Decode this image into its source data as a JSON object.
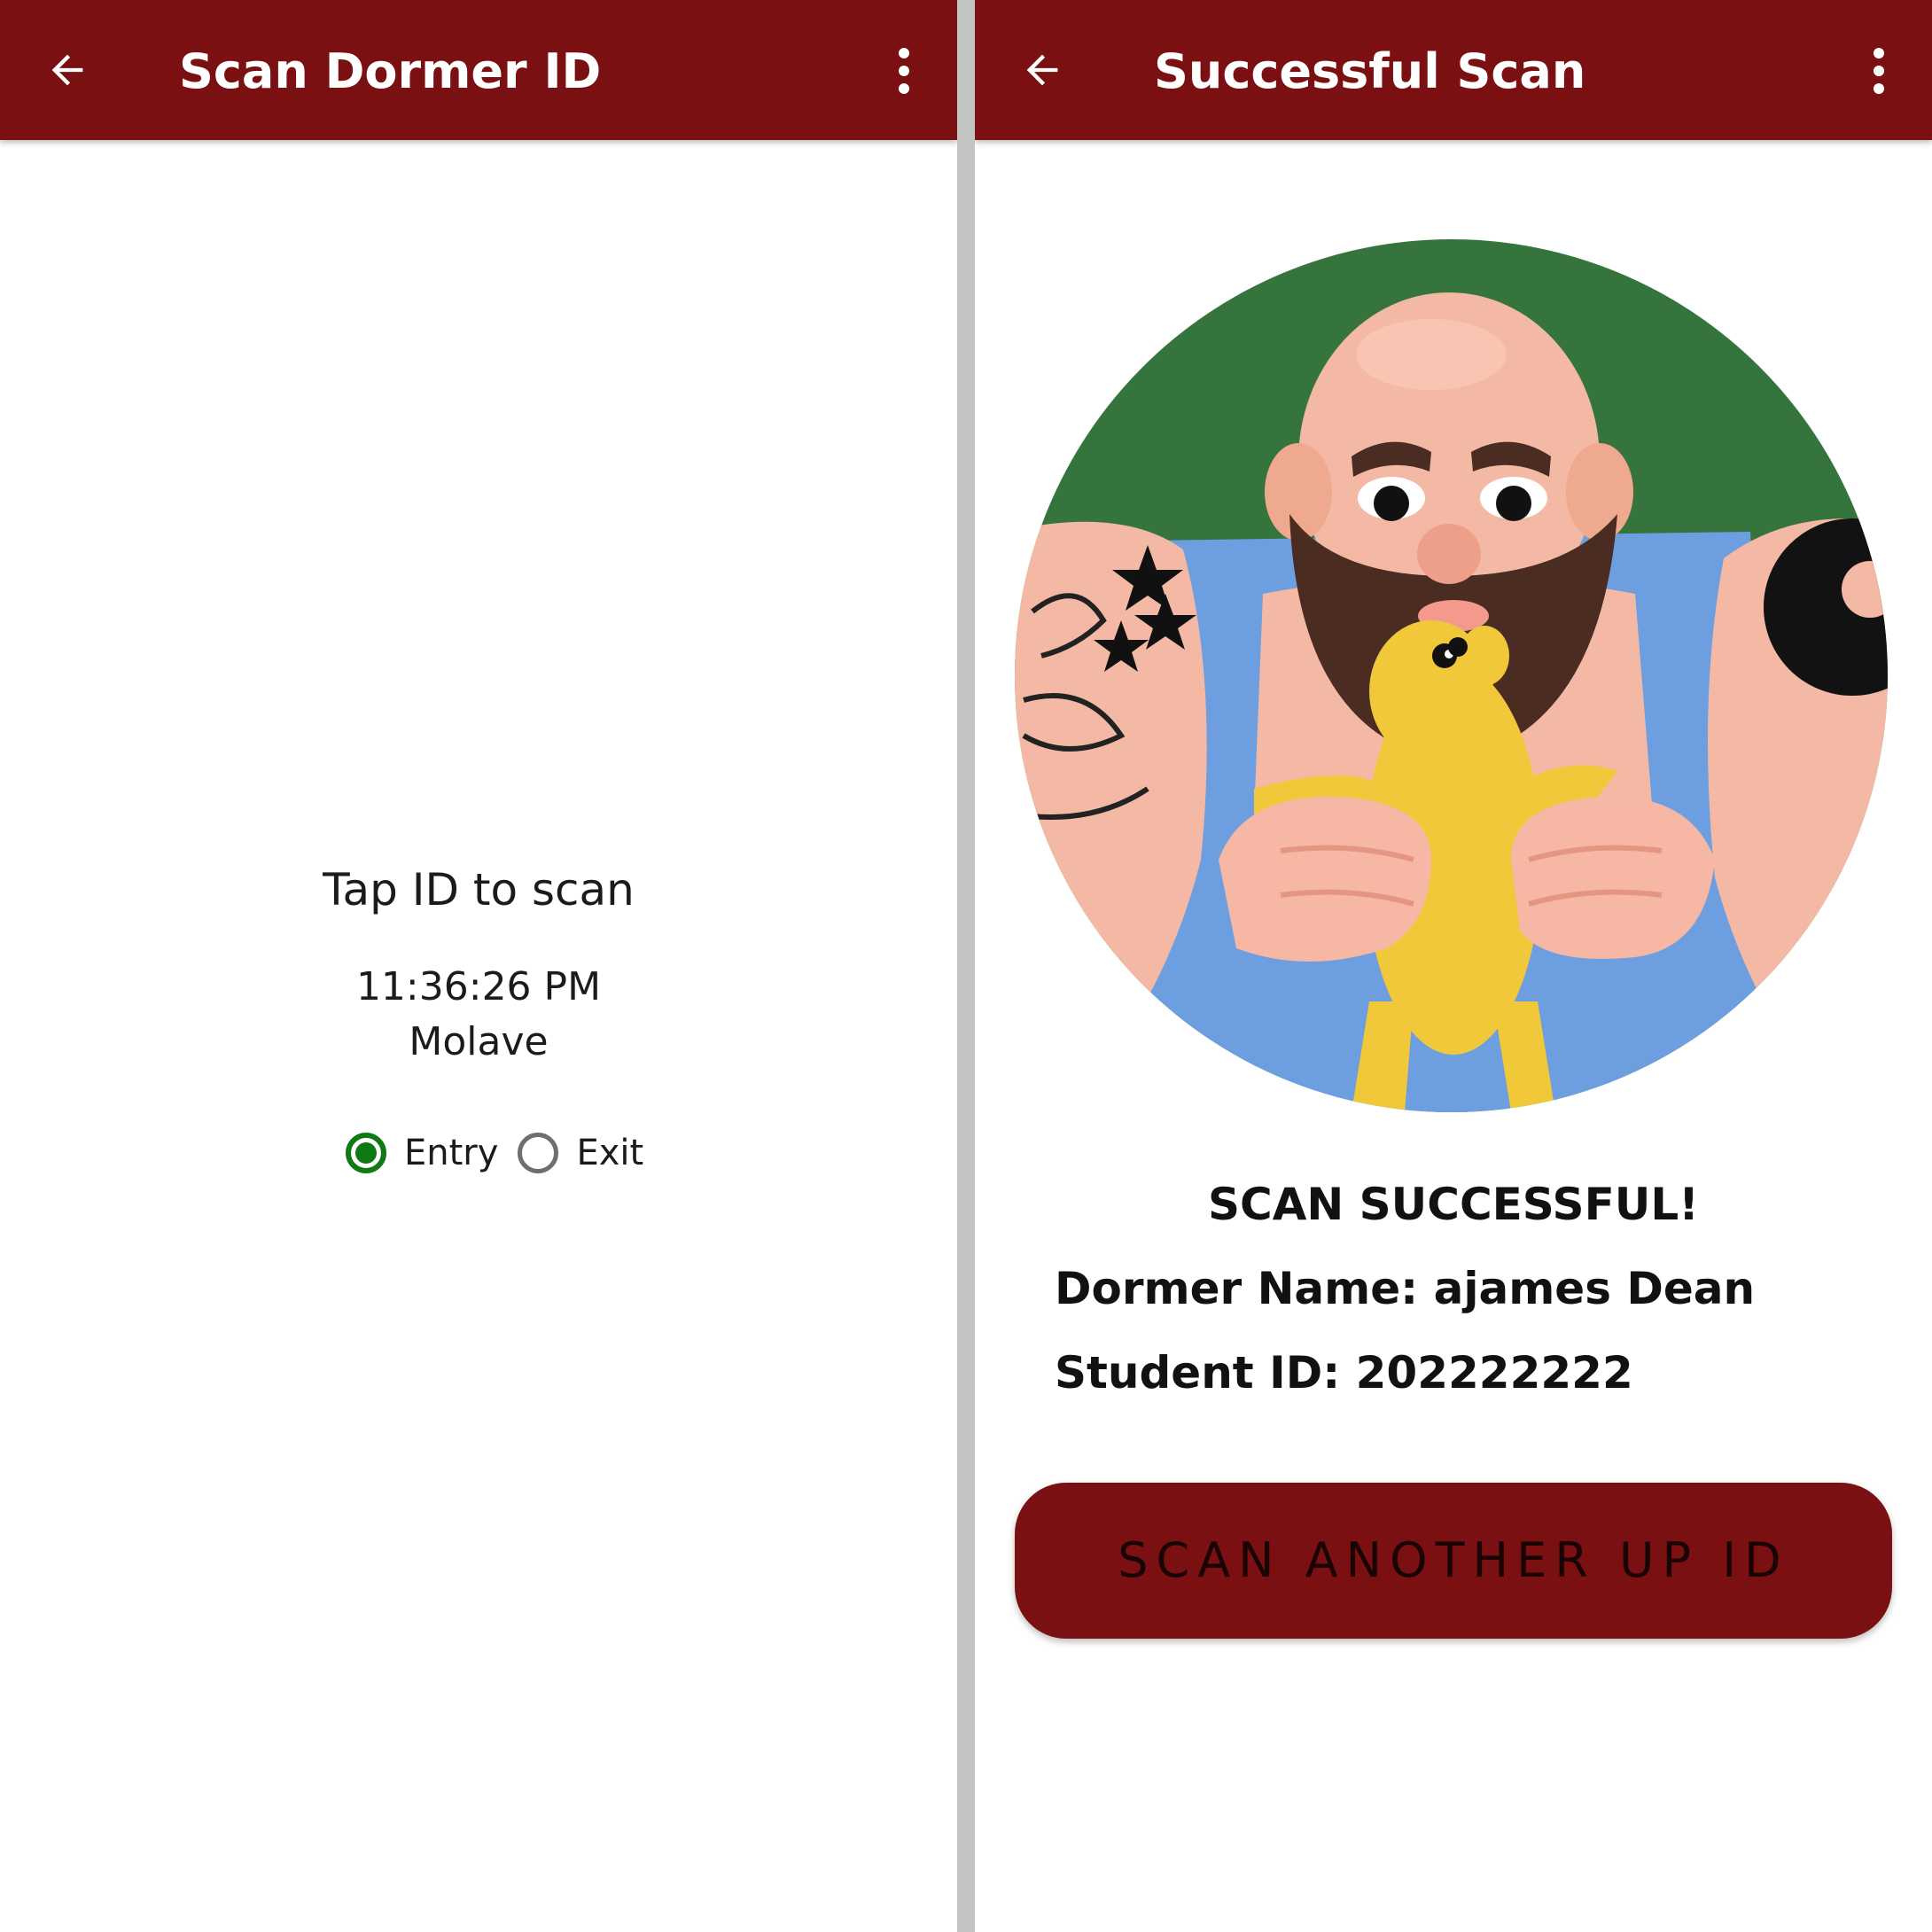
{
  "theme": {
    "primary": "#7a1012",
    "radio_selected": "#0f7a14",
    "avatar_background": "#36743d"
  },
  "left_screen": {
    "title": "Scan Dormer ID",
    "back_icon": "arrow-left-icon",
    "menu_icon": "more-vertical-icon",
    "prompt": "Tap ID to scan",
    "time": "11:36:26 PM",
    "location": "Molave",
    "direction": {
      "selected": "Entry",
      "options": [
        {
          "label": "Entry",
          "checked": true
        },
        {
          "label": "Exit",
          "checked": false
        }
      ]
    }
  },
  "right_screen": {
    "title": "Successful Scan",
    "back_icon": "arrow-left-icon",
    "menu_icon": "more-vertical-icon",
    "avatar": "bearded-man-holding-yellow-puppy",
    "status": "SCAN SUCCESSFUL!",
    "dormer_name_line": "Dormer Name: ajames Dean",
    "student_id_line": "Student ID: 202222222",
    "button_label": "SCAN ANOTHER UP ID"
  }
}
